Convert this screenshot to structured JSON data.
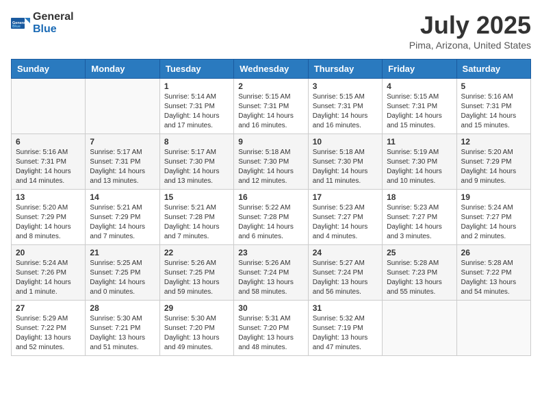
{
  "header": {
    "logo_general": "General",
    "logo_blue": "Blue",
    "month_title": "July 2025",
    "location": "Pima, Arizona, United States"
  },
  "weekdays": [
    "Sunday",
    "Monday",
    "Tuesday",
    "Wednesday",
    "Thursday",
    "Friday",
    "Saturday"
  ],
  "days": [
    {
      "day": "",
      "empty": true
    },
    {
      "day": "",
      "empty": true
    },
    {
      "day": "1",
      "sunrise": "5:14 AM",
      "sunset": "7:31 PM",
      "daylight": "14 hours and 17 minutes."
    },
    {
      "day": "2",
      "sunrise": "5:15 AM",
      "sunset": "7:31 PM",
      "daylight": "14 hours and 16 minutes."
    },
    {
      "day": "3",
      "sunrise": "5:15 AM",
      "sunset": "7:31 PM",
      "daylight": "14 hours and 16 minutes."
    },
    {
      "day": "4",
      "sunrise": "5:15 AM",
      "sunset": "7:31 PM",
      "daylight": "14 hours and 15 minutes."
    },
    {
      "day": "5",
      "sunrise": "5:16 AM",
      "sunset": "7:31 PM",
      "daylight": "14 hours and 15 minutes."
    },
    {
      "day": "6",
      "sunrise": "5:16 AM",
      "sunset": "7:31 PM",
      "daylight": "14 hours and 14 minutes."
    },
    {
      "day": "7",
      "sunrise": "5:17 AM",
      "sunset": "7:31 PM",
      "daylight": "14 hours and 13 minutes."
    },
    {
      "day": "8",
      "sunrise": "5:17 AM",
      "sunset": "7:30 PM",
      "daylight": "14 hours and 13 minutes."
    },
    {
      "day": "9",
      "sunrise": "5:18 AM",
      "sunset": "7:30 PM",
      "daylight": "14 hours and 12 minutes."
    },
    {
      "day": "10",
      "sunrise": "5:18 AM",
      "sunset": "7:30 PM",
      "daylight": "14 hours and 11 minutes."
    },
    {
      "day": "11",
      "sunrise": "5:19 AM",
      "sunset": "7:30 PM",
      "daylight": "14 hours and 10 minutes."
    },
    {
      "day": "12",
      "sunrise": "5:20 AM",
      "sunset": "7:29 PM",
      "daylight": "14 hours and 9 minutes."
    },
    {
      "day": "13",
      "sunrise": "5:20 AM",
      "sunset": "7:29 PM",
      "daylight": "14 hours and 8 minutes."
    },
    {
      "day": "14",
      "sunrise": "5:21 AM",
      "sunset": "7:29 PM",
      "daylight": "14 hours and 7 minutes."
    },
    {
      "day": "15",
      "sunrise": "5:21 AM",
      "sunset": "7:28 PM",
      "daylight": "14 hours and 7 minutes."
    },
    {
      "day": "16",
      "sunrise": "5:22 AM",
      "sunset": "7:28 PM",
      "daylight": "14 hours and 6 minutes."
    },
    {
      "day": "17",
      "sunrise": "5:23 AM",
      "sunset": "7:27 PM",
      "daylight": "14 hours and 4 minutes."
    },
    {
      "day": "18",
      "sunrise": "5:23 AM",
      "sunset": "7:27 PM",
      "daylight": "14 hours and 3 minutes."
    },
    {
      "day": "19",
      "sunrise": "5:24 AM",
      "sunset": "7:27 PM",
      "daylight": "14 hours and 2 minutes."
    },
    {
      "day": "20",
      "sunrise": "5:24 AM",
      "sunset": "7:26 PM",
      "daylight": "14 hours and 1 minute."
    },
    {
      "day": "21",
      "sunrise": "5:25 AM",
      "sunset": "7:25 PM",
      "daylight": "14 hours and 0 minutes."
    },
    {
      "day": "22",
      "sunrise": "5:26 AM",
      "sunset": "7:25 PM",
      "daylight": "13 hours and 59 minutes."
    },
    {
      "day": "23",
      "sunrise": "5:26 AM",
      "sunset": "7:24 PM",
      "daylight": "13 hours and 58 minutes."
    },
    {
      "day": "24",
      "sunrise": "5:27 AM",
      "sunset": "7:24 PM",
      "daylight": "13 hours and 56 minutes."
    },
    {
      "day": "25",
      "sunrise": "5:28 AM",
      "sunset": "7:23 PM",
      "daylight": "13 hours and 55 minutes."
    },
    {
      "day": "26",
      "sunrise": "5:28 AM",
      "sunset": "7:22 PM",
      "daylight": "13 hours and 54 minutes."
    },
    {
      "day": "27",
      "sunrise": "5:29 AM",
      "sunset": "7:22 PM",
      "daylight": "13 hours and 52 minutes."
    },
    {
      "day": "28",
      "sunrise": "5:30 AM",
      "sunset": "7:21 PM",
      "daylight": "13 hours and 51 minutes."
    },
    {
      "day": "29",
      "sunrise": "5:30 AM",
      "sunset": "7:20 PM",
      "daylight": "13 hours and 49 minutes."
    },
    {
      "day": "30",
      "sunrise": "5:31 AM",
      "sunset": "7:20 PM",
      "daylight": "13 hours and 48 minutes."
    },
    {
      "day": "31",
      "sunrise": "5:32 AM",
      "sunset": "7:19 PM",
      "daylight": "13 hours and 47 minutes."
    },
    {
      "day": "",
      "empty": true
    },
    {
      "day": "",
      "empty": true
    }
  ],
  "labels": {
    "sunrise": "Sunrise:",
    "sunset": "Sunset:",
    "daylight": "Daylight:"
  }
}
